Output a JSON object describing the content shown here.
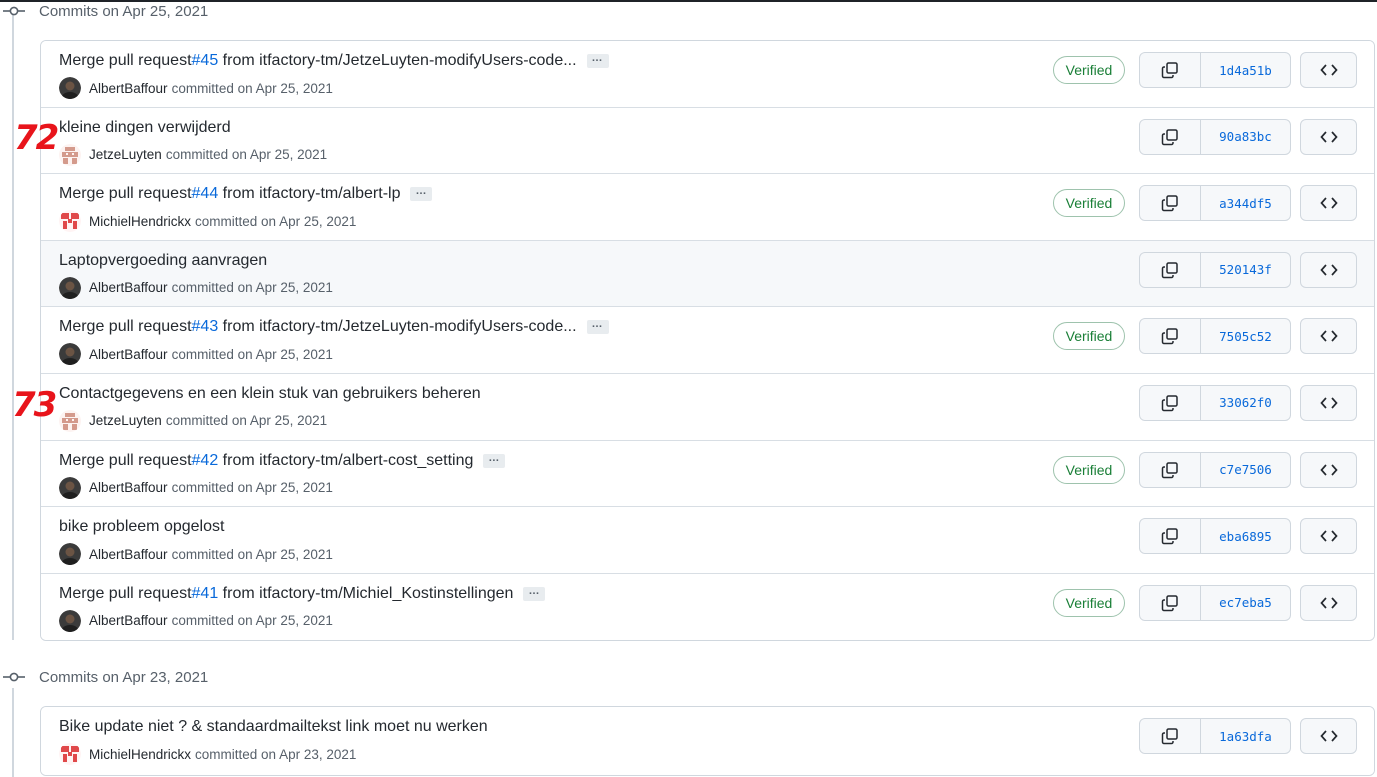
{
  "groups": [
    {
      "title": "Commits on Apr 25, 2021",
      "commits": [
        {
          "prefix": "Merge pull request ",
          "pr": "#45",
          "rest": " from itfactory-tm/JetzeLuyten-modifyUsers-code...",
          "ellipsis": "…",
          "author": "AlbertBaffour",
          "when": "committed on Apr 25, 2021",
          "verified": "Verified",
          "sha": "1d4a51b",
          "avatar": "albert",
          "highlight": false
        },
        {
          "prefix": "kleine dingen verwijderd",
          "pr": "",
          "rest": "",
          "ellipsis": "",
          "author": "JetzeLuyten",
          "when": "committed on Apr 25, 2021",
          "verified": "",
          "sha": "90a83bc",
          "avatar": "jetze",
          "highlight": false
        },
        {
          "prefix": "Merge pull request ",
          "pr": "#44",
          "rest": " from itfactory-tm/albert-lp",
          "ellipsis": "…",
          "author": "MichielHendrickx",
          "when": "committed on Apr 25, 2021",
          "verified": "Verified",
          "sha": "a344df5",
          "avatar": "michiel",
          "highlight": false
        },
        {
          "prefix": "Laptopvergoeding aanvragen",
          "pr": "",
          "rest": "",
          "ellipsis": "",
          "author": "AlbertBaffour",
          "when": "committed on Apr 25, 2021",
          "verified": "",
          "sha": "520143f",
          "avatar": "albert",
          "highlight": true
        },
        {
          "prefix": "Merge pull request ",
          "pr": "#43",
          "rest": " from itfactory-tm/JetzeLuyten-modifyUsers-code...",
          "ellipsis": "…",
          "author": "AlbertBaffour",
          "when": "committed on Apr 25, 2021",
          "verified": "Verified",
          "sha": "7505c52",
          "avatar": "albert",
          "highlight": false
        },
        {
          "prefix": "Contactgegevens en een klein stuk van gebruikers beheren",
          "pr": "",
          "rest": "",
          "ellipsis": "",
          "author": "JetzeLuyten",
          "when": "committed on Apr 25, 2021",
          "verified": "",
          "sha": "33062f0",
          "avatar": "jetze",
          "highlight": false
        },
        {
          "prefix": "Merge pull request ",
          "pr": "#42",
          "rest": " from itfactory-tm/albert-cost_setting",
          "ellipsis": "…",
          "author": "AlbertBaffour",
          "when": "committed on Apr 25, 2021",
          "verified": "Verified",
          "sha": "c7e7506",
          "avatar": "albert",
          "highlight": false
        },
        {
          "prefix": "bike probleem opgelost",
          "pr": "",
          "rest": "",
          "ellipsis": "",
          "author": "AlbertBaffour",
          "when": "committed on Apr 25, 2021",
          "verified": "",
          "sha": "eba6895",
          "avatar": "albert",
          "highlight": false
        },
        {
          "prefix": "Merge pull request ",
          "pr": "#41",
          "rest": " from itfactory-tm/Michiel_Kostinstellingen",
          "ellipsis": "…",
          "author": "AlbertBaffour",
          "when": "committed on Apr 25, 2021",
          "verified": "Verified",
          "sha": "ec7eba5",
          "avatar": "albert",
          "highlight": false
        }
      ]
    },
    {
      "title": "Commits on Apr 23, 2021",
      "commits": [
        {
          "prefix": "Bike update niet ? & standaardmailtekst link moet nu werken",
          "pr": "",
          "rest": "",
          "ellipsis": "",
          "author": "MichielHendrickx",
          "when": "committed on Apr 23, 2021",
          "verified": "",
          "sha": "1a63dfa",
          "avatar": "michiel",
          "highlight": false
        }
      ]
    }
  ],
  "annotations": [
    "72",
    "73"
  ],
  "colors": {
    "link": "#0969da",
    "verified": "#1a7f37",
    "annotation": "#e8141b"
  },
  "icons": {
    "commit": "git-commit-icon",
    "copy": "copy-icon",
    "browse": "code-icon"
  }
}
